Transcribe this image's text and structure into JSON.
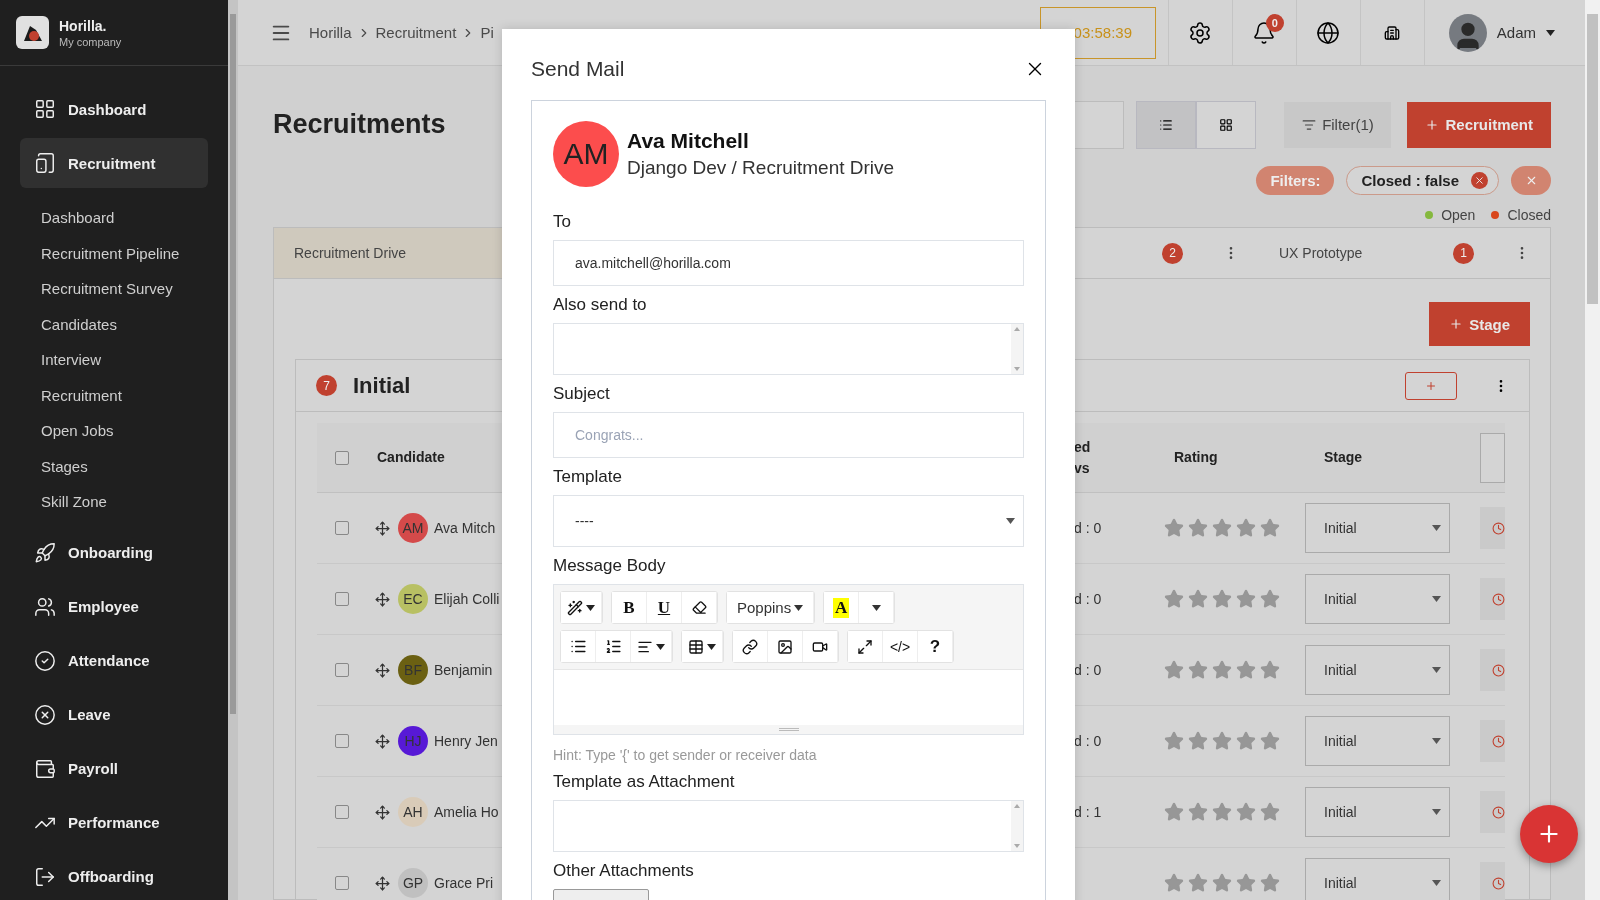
{
  "brand": {
    "name": "Horilla.",
    "company": "My company"
  },
  "sidebar": {
    "items": [
      {
        "label": "Dashboard",
        "selected": false
      },
      {
        "label": "Recruitment",
        "selected": true,
        "expanded": true,
        "children": [
          {
            "label": "Dashboard"
          },
          {
            "label": "Recruitment Pipeline"
          },
          {
            "label": "Recruitment Survey"
          },
          {
            "label": "Candidates"
          },
          {
            "label": "Interview"
          },
          {
            "label": "Recruitment"
          },
          {
            "label": "Open Jobs"
          },
          {
            "label": "Stages"
          },
          {
            "label": "Skill Zone"
          }
        ]
      },
      {
        "label": "Onboarding",
        "selected": false
      },
      {
        "label": "Employee",
        "selected": false
      },
      {
        "label": "Attendance",
        "selected": false
      },
      {
        "label": "Leave",
        "selected": false
      },
      {
        "label": "Payroll",
        "selected": false
      },
      {
        "label": "Performance",
        "selected": false
      },
      {
        "label": "Offboarding",
        "selected": false
      }
    ]
  },
  "header": {
    "breadcrumb": [
      "Horilla",
      "Recruitment",
      "Pi"
    ],
    "timer": "03:58:39",
    "notifications": "0",
    "user": "Adam"
  },
  "page": {
    "title": "Recruitments",
    "views": [
      {
        "selected": true
      },
      {
        "selected": false
      }
    ],
    "filter_button": "Filter(1)",
    "add_button": "Recruitment"
  },
  "filters": {
    "label": "Filters:",
    "tags": [
      "Closed : false"
    ]
  },
  "legend": [
    {
      "label": "Open",
      "color": "#85b83e"
    },
    {
      "label": "Closed",
      "color": "#d8461c"
    }
  ],
  "tabs": [
    {
      "label": "Recruitment Drive",
      "selected": true
    },
    {
      "count": "2",
      "selected": false
    },
    {
      "label": "UX Prototype",
      "count": "1",
      "selected": false
    }
  ],
  "stage_button": "Stage",
  "stage": {
    "count": "7",
    "title": "Initial"
  },
  "table": {
    "all_selected": false,
    "columns": [
      "Candidate",
      "ed\nvs",
      "Rating",
      "Stage"
    ],
    "rows": [
      {
        "selected": false,
        "initials": "AM",
        "color": "#d44a4a",
        "name": "Ava Mitch",
        "column_3": "d : 0",
        "stars": 0,
        "stage": "Initial"
      },
      {
        "selected": false,
        "initials": "EC",
        "color": "#b8c063",
        "name": "Elijah Colli",
        "column_3": "d : 0",
        "stars": 0,
        "stage": "Initial"
      },
      {
        "selected": false,
        "initials": "BF",
        "color": "#6b6012",
        "name": "Benjamin",
        "column_3": "d : 0",
        "stars": 0,
        "stage": "Initial"
      },
      {
        "selected": false,
        "initials": "HJ",
        "color": "#5719d6",
        "name": "Henry Jen",
        "column_3": "d : 0",
        "stars": 0,
        "stage": "Initial"
      },
      {
        "selected": false,
        "initials": "AH",
        "color": "#d9cbb8",
        "name": "Amelia Ho",
        "column_3": "d : 1",
        "stars": 0,
        "stage": "Initial"
      },
      {
        "selected": false,
        "initials": "GP",
        "color": "#c0c0c0",
        "name": "Grace Pri",
        "stars": 0,
        "stage": "Initial"
      }
    ]
  },
  "modal": {
    "title": "Send Mail",
    "candidate": {
      "initials": "AM",
      "color": "#fc4d4d",
      "name": "Ava Mitchell",
      "subtitle": "Django Dev / Recruitment Drive"
    },
    "fields": [
      {
        "kind": "input",
        "label": "To",
        "value": "ava.mitchell@horilla.com"
      },
      {
        "kind": "textarea",
        "label": "Also send to"
      },
      {
        "kind": "input",
        "label": "Subject",
        "placeholder": "Congrats..."
      },
      {
        "kind": "select",
        "label": "Template",
        "value": "----"
      },
      {
        "kind": "editor",
        "label": "Message Body",
        "bold": "B",
        "underline": "U",
        "font": "Poppins",
        "color_letter": "A",
        "code": "</>",
        "help": "?",
        "hint": "Hint: Type '{' to get sender or receiver data"
      },
      {
        "kind": "textarea",
        "label": "Template as Attachment"
      },
      {
        "kind": "file",
        "label": "Other Attachments"
      }
    ]
  }
}
